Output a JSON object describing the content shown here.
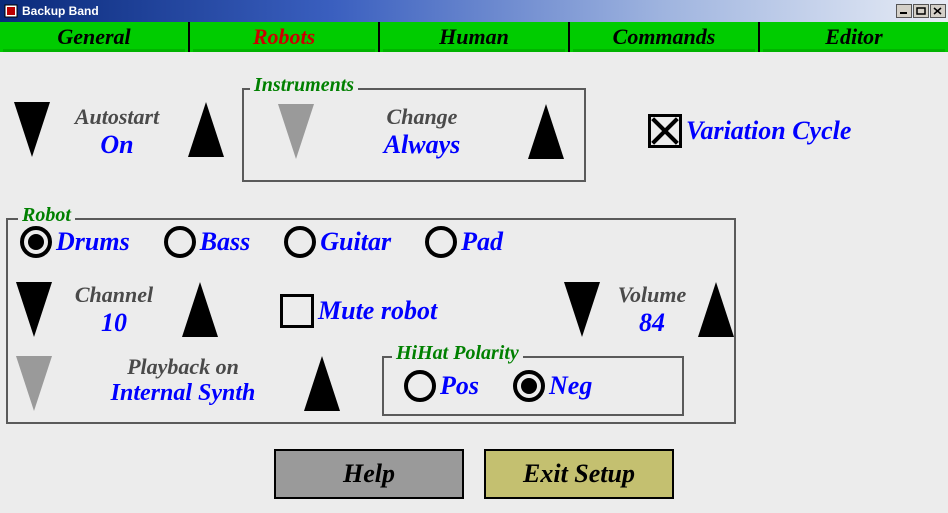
{
  "window": {
    "title": "Backup Band",
    "min_icon": "_",
    "max_icon": "□",
    "close_icon": "×"
  },
  "tabs": {
    "general": "General",
    "robots": "Robots",
    "human": "Human",
    "commands": "Commands",
    "editor": "Editor",
    "active": "robots"
  },
  "autostart": {
    "label": "Autostart",
    "value": "On"
  },
  "instruments": {
    "legend": "Instruments",
    "change_label": "Change",
    "change_value": "Always"
  },
  "variation_cycle": {
    "label": "Variation Cycle",
    "checked": true
  },
  "robot": {
    "legend": "Robot",
    "options": {
      "drums": "Drums",
      "bass": "Bass",
      "guitar": "Guitar",
      "pad": "Pad"
    },
    "selected": "drums",
    "channel": {
      "label": "Channel",
      "value": "10"
    },
    "mute": {
      "label": "Mute robot",
      "checked": false
    },
    "volume": {
      "label": "Volume",
      "value": "84"
    },
    "playback": {
      "label": "Playback on",
      "value": "Internal Synth"
    }
  },
  "hihat": {
    "legend": "HiHat Polarity",
    "pos": "Pos",
    "neg": "Neg",
    "selected": "neg"
  },
  "buttons": {
    "help": "Help",
    "exit": "Exit Setup"
  }
}
